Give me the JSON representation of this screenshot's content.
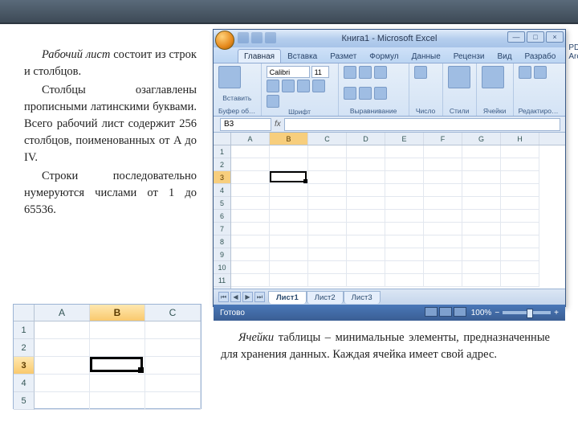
{
  "paragraphs": {
    "p1_term": "Рабочий лист",
    "p1_rest": " состоит из строк и столбцов.",
    "p2": "Столбцы озаглавлены прописными латинскими буквами. Всего рабочий лист содержит 256 столбцов, поименованных от A до IV.",
    "p3": "Строки последовательно нумеруются числами от 1 до 65536.",
    "p4_term": "Ячейки",
    "p4_rest": " таблицы – минимальные элементы, предназначенные для хранения данных. Каждая ячейка имеет свой адрес."
  },
  "excel": {
    "title": "Книга1 - Microsoft Excel",
    "tabs": [
      "Главная",
      "Вставка",
      "Размет",
      "Формул",
      "Данные",
      "Рецензи",
      "Вид",
      "Разрабо",
      "PDF Arc"
    ],
    "active_tab": 0,
    "groups": {
      "clipboard": "Буфер обме...",
      "paste": "Вставить",
      "font": "Шрифт",
      "font_name": "Calibri",
      "font_size": "11",
      "align": "Выравнивание",
      "number": "Число",
      "styles": "Стили",
      "cells": "Ячейки",
      "editing": "Редактирован..."
    },
    "namebox": "B3",
    "fx": "fx",
    "columns": [
      "A",
      "B",
      "C",
      "D",
      "E",
      "F",
      "G",
      "H"
    ],
    "rows": [
      "1",
      "2",
      "3",
      "4",
      "5",
      "6",
      "7",
      "8",
      "9",
      "10",
      "11"
    ],
    "selected": {
      "col": "B",
      "row": "3"
    },
    "sheets": [
      "Лист1",
      "Лист2",
      "Лист3"
    ],
    "active_sheet": 0,
    "status": "Готово",
    "zoom": "100%"
  },
  "fragment": {
    "columns": [
      "A",
      "B",
      "C"
    ],
    "rows": [
      "1",
      "2",
      "3",
      "4",
      "5"
    ],
    "selected": {
      "col": "B",
      "row": "3"
    }
  }
}
